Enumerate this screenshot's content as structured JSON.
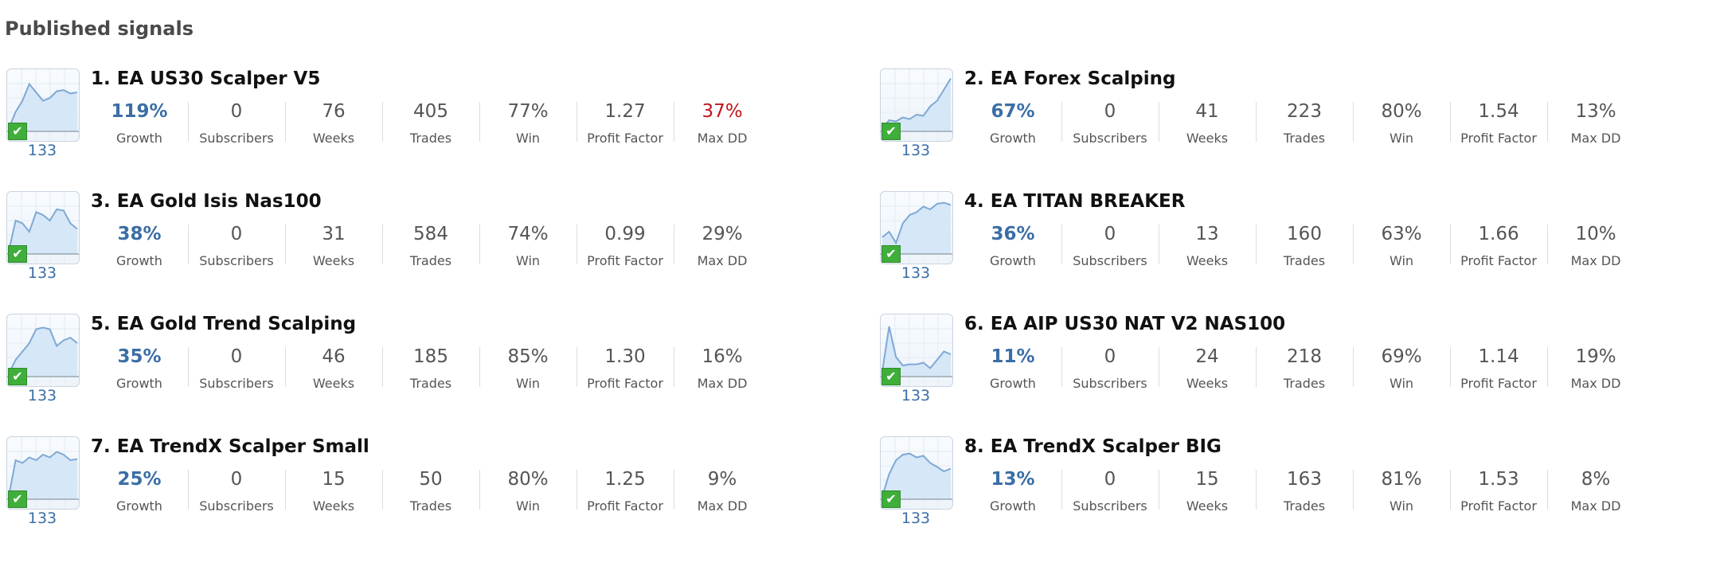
{
  "page": {
    "title": "Published signals"
  },
  "colors": {
    "growth": "#3a6ea5",
    "danger": "#c0151c",
    "check": "#3fae3a",
    "chart_line": "#7fa9d4",
    "chart_fill": "#d6e7f7"
  },
  "icons": {
    "verified": "check-icon"
  },
  "labels": [
    "Growth",
    "Subscribers",
    "Weeks",
    "Trades",
    "Win",
    "Profit Factor",
    "Max DD"
  ],
  "signals": [
    {
      "name": "1. EA US30 Scalper V5",
      "count": "133",
      "growth": "119%",
      "subscribers": "0",
      "weeks": "76",
      "trades": "405",
      "win": "77%",
      "profit_factor": "1.27",
      "max_dd": "37%",
      "max_dd_alert": true,
      "spark": [
        5,
        35,
        55,
        85,
        70,
        55,
        60,
        72,
        74,
        68,
        70
      ]
    },
    {
      "name": "2. EA Forex Scalping",
      "count": "133",
      "growth": "67%",
      "subscribers": "0",
      "weeks": "41",
      "trades": "223",
      "win": "80%",
      "profit_factor": "1.54",
      "max_dd": "13%",
      "max_dd_alert": false,
      "spark": [
        5,
        20,
        18,
        25,
        22,
        30,
        28,
        45,
        55,
        75,
        95
      ]
    },
    {
      "name": "3. EA Gold Isis Nas100",
      "count": "133",
      "growth": "38%",
      "subscribers": "0",
      "weeks": "31",
      "trades": "584",
      "win": "74%",
      "profit_factor": "0.99",
      "max_dd": "29%",
      "max_dd_alert": false,
      "spark": [
        5,
        60,
        55,
        40,
        75,
        70,
        60,
        80,
        78,
        55,
        45
      ]
    },
    {
      "name": "4. EA TITAN BREAKER",
      "count": "133",
      "growth": "36%",
      "subscribers": "0",
      "weeks": "13",
      "trades": "160",
      "win": "63%",
      "profit_factor": "1.66",
      "max_dd": "10%",
      "max_dd_alert": false,
      "spark": [
        30,
        40,
        20,
        55,
        70,
        75,
        85,
        80,
        90,
        92,
        88
      ]
    },
    {
      "name": "5. EA Gold Trend Scalping",
      "count": "133",
      "growth": "35%",
      "subscribers": "0",
      "weeks": "46",
      "trades": "185",
      "win": "85%",
      "profit_factor": "1.30",
      "max_dd": "16%",
      "max_dd_alert": false,
      "spark": [
        5,
        30,
        45,
        60,
        85,
        88,
        85,
        55,
        65,
        70,
        60
      ]
    },
    {
      "name": "6. EA AIP US30 NAT V2 NAS100",
      "count": "133",
      "growth": "11%",
      "subscribers": "0",
      "weeks": "24",
      "trades": "218",
      "win": "69%",
      "profit_factor": "1.14",
      "max_dd": "19%",
      "max_dd_alert": false,
      "spark": [
        10,
        90,
        35,
        20,
        22,
        22,
        25,
        15,
        30,
        45,
        40
      ]
    },
    {
      "name": "7. EA TrendX Scalper Small",
      "count": "133",
      "growth": "25%",
      "subscribers": "0",
      "weeks": "15",
      "trades": "50",
      "win": "80%",
      "profit_factor": "1.25",
      "max_dd": "9%",
      "max_dd_alert": false,
      "spark": [
        5,
        70,
        65,
        75,
        70,
        80,
        75,
        85,
        80,
        70,
        72
      ]
    },
    {
      "name": "8. EA TrendX Scalper BIG",
      "count": "133",
      "growth": "13%",
      "subscribers": "0",
      "weeks": "15",
      "trades": "163",
      "win": "81%",
      "profit_factor": "1.53",
      "max_dd": "8%",
      "max_dd_alert": false,
      "spark": [
        5,
        45,
        70,
        80,
        82,
        75,
        78,
        65,
        58,
        50,
        55
      ]
    }
  ]
}
